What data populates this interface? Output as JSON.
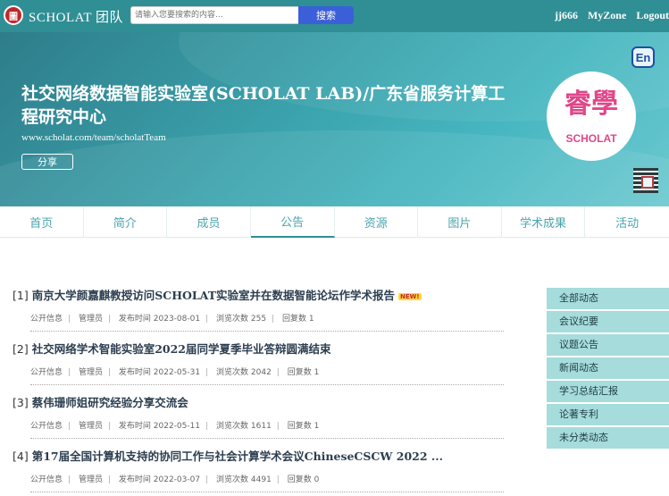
{
  "topbar": {
    "logo_glyph": "圖",
    "brand": "SCHOLAT 团队",
    "search_placeholder": "请输入您要搜索的内容...",
    "search_button": "搜索",
    "user": "jj666",
    "myzone": "MyZone",
    "logout": "Logout"
  },
  "banner": {
    "title": "社交网络数据智能实验室(SCHOLAT LAB)/广东省服务计算工程研究中心",
    "url": "www.scholat.com/team/scholatTeam",
    "share": "分享",
    "lang_button": "En",
    "logo_mark": "睿學",
    "logo_text": "SCHOLAT"
  },
  "nav": {
    "tabs": [
      {
        "label": "首页"
      },
      {
        "label": "简介"
      },
      {
        "label": "成员"
      },
      {
        "label": "公告",
        "active": true
      },
      {
        "label": "资源"
      },
      {
        "label": "图片"
      },
      {
        "label": "学术成果"
      },
      {
        "label": "活动"
      }
    ]
  },
  "posts": [
    {
      "index": "[1]",
      "title": "南京大学颜嘉麒教授访问SCHOLAT实验室并在数据智能论坛作学术报告",
      "badge": "NEW!",
      "visibility": "公开信息",
      "author": "管理员",
      "published_label": "发布时间",
      "published": "2023-08-01",
      "views_label": "浏览次数",
      "views": "255",
      "replies_label": "回复数",
      "replies": "1"
    },
    {
      "index": "[2]",
      "title": "社交网络学术智能实验室2022届同学夏季毕业答辩圆满结束",
      "badge": "",
      "visibility": "公开信息",
      "author": "管理员",
      "published_label": "发布时间",
      "published": "2022-05-31",
      "views_label": "浏览次数",
      "views": "2042",
      "replies_label": "回复数",
      "replies": "1"
    },
    {
      "index": "[3]",
      "title": "蔡伟珊师姐研究经验分享交流会",
      "badge": "",
      "visibility": "公开信息",
      "author": "管理员",
      "published_label": "发布时间",
      "published": "2022-05-11",
      "views_label": "浏览次数",
      "views": "1611",
      "replies_label": "回复数",
      "replies": "1"
    },
    {
      "index": "[4]",
      "title": "第17届全国计算机支持的协同工作与社会计算学术会议ChineseCSCW 2022 ...",
      "badge": "",
      "visibility": "公开信息",
      "author": "管理员",
      "published_label": "发布时间",
      "published": "2022-03-07",
      "views_label": "浏览次数",
      "views": "4491",
      "replies_label": "回复数",
      "replies": "0"
    }
  ],
  "side_menu": [
    {
      "label": "全部动态"
    },
    {
      "label": "会议纪要"
    },
    {
      "label": "议题公告"
    },
    {
      "label": "新闻动态"
    },
    {
      "label": "学习总结汇报"
    },
    {
      "label": "论著专利"
    },
    {
      "label": "未分类动态"
    }
  ],
  "colors": {
    "topbar": "#2f8f95",
    "search_button": "#3b5fd9",
    "tab_text": "#4aa5ad",
    "side_item": "#a6dcdc"
  }
}
